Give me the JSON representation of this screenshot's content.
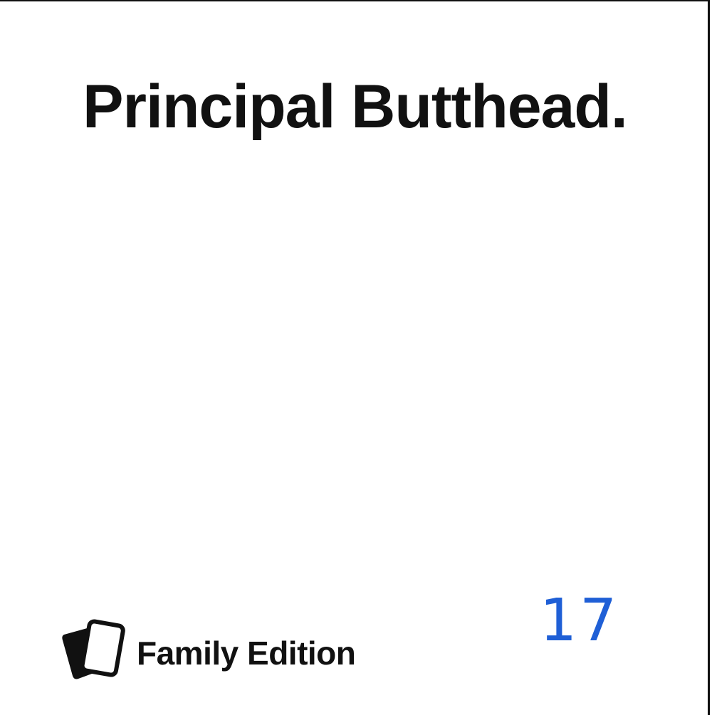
{
  "card": {
    "text": "Principal Butthead.",
    "edition_label": "Family Edition",
    "brand_icon": "stacked-cards-icon",
    "handwritten_number": "17",
    "colors": {
      "card_background": "#ffffff",
      "text": "#111111",
      "handwriting": "#1f5fd6"
    }
  }
}
